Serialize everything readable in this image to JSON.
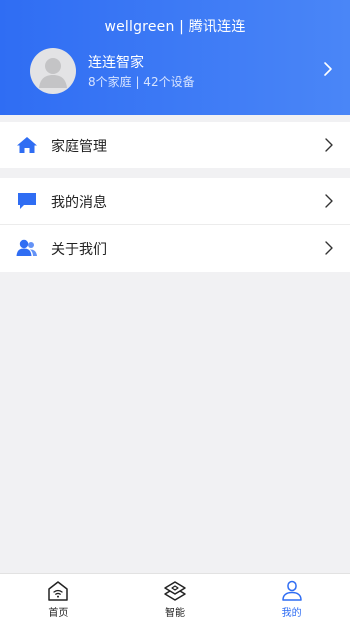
{
  "header": {
    "title": "wellgreen | 腾讯连连",
    "profile": {
      "name": "连连智家",
      "summary": "8个家庭 | 42个设备"
    }
  },
  "menu": {
    "family": {
      "label": "家庭管理",
      "icon": "home-icon"
    },
    "messages": {
      "label": "我的消息",
      "icon": "message-icon"
    },
    "about": {
      "label": "关于我们",
      "icon": "people-icon"
    }
  },
  "tabbar": {
    "tabs": [
      {
        "label": "首页",
        "icon": "home-wifi-icon",
        "active": false
      },
      {
        "label": "智能",
        "icon": "layers-icon",
        "active": false
      },
      {
        "label": "我的",
        "icon": "user-icon",
        "active": true
      }
    ]
  },
  "colors": {
    "accent": "#2f6df3",
    "header_gradient_start": "#2f6df3",
    "header_gradient_end": "#4a86f7",
    "background": "#f1f1f3"
  }
}
